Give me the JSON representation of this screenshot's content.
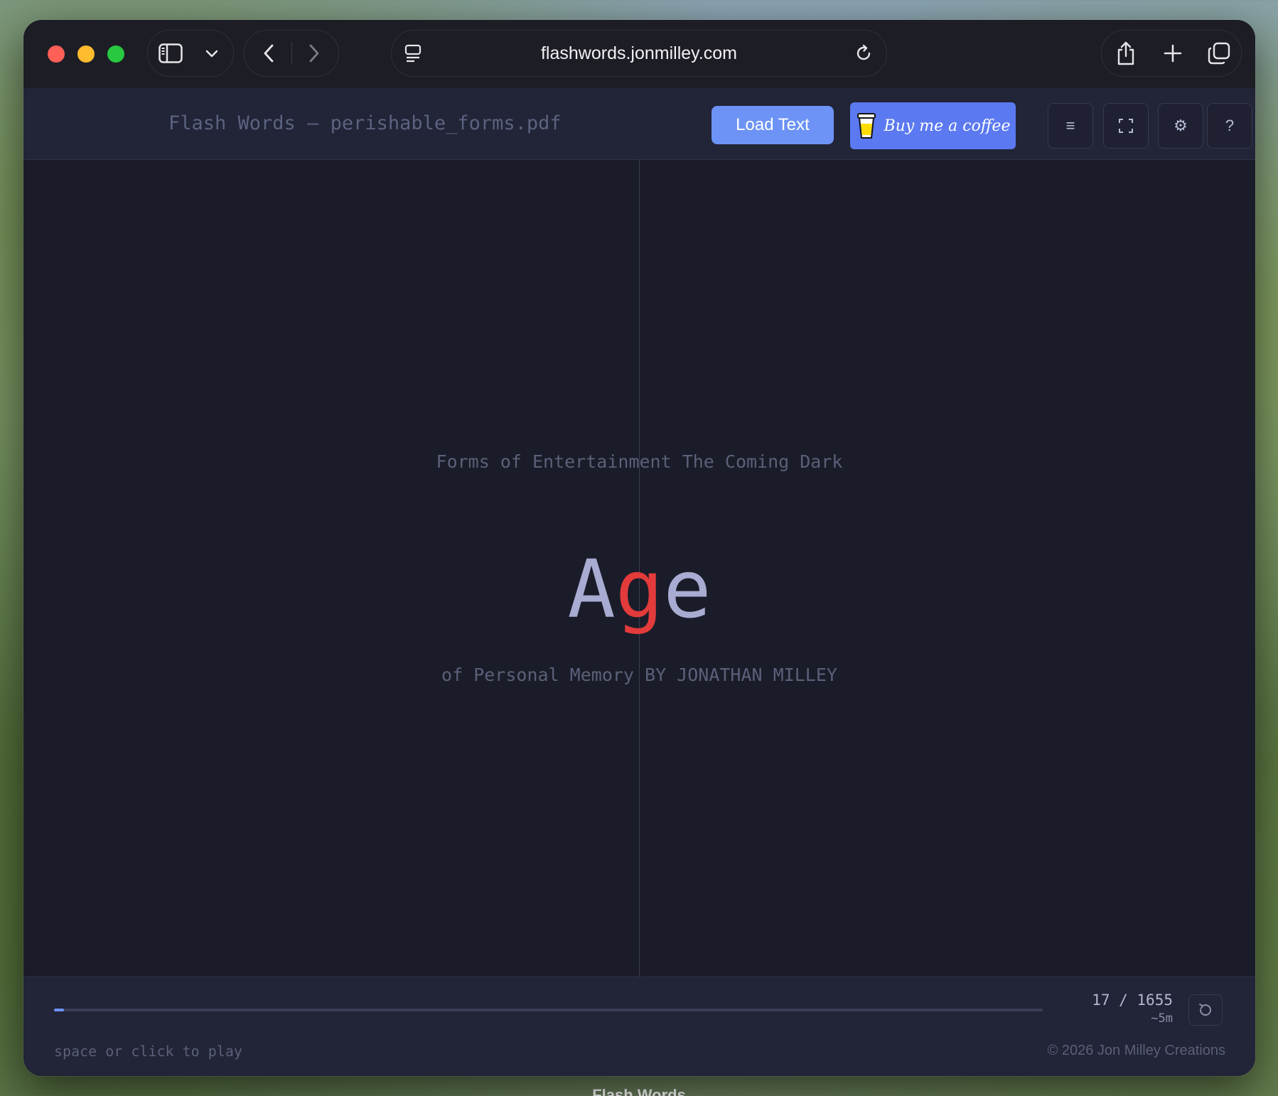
{
  "browser": {
    "url": "flashwords.jonmilley.com"
  },
  "app": {
    "title": "Flash Words – perishable_forms.pdf",
    "load_label": "Load Text",
    "coffee_label": "Buy me a coffee",
    "menu_glyph": "≡",
    "fullscreen_glyph": "⛶",
    "settings_glyph": "⚙",
    "help_glyph": "?"
  },
  "reader": {
    "context_before": "Forms of Entertainment The Coming Dark",
    "word_pre": "A",
    "word_orp": "g",
    "word_post": "e",
    "context_after": "of Personal Memory BY JONATHAN MILLEY",
    "orp_color": "#e33b3b",
    "word_color": "#a8acd2"
  },
  "footer": {
    "count": "17 / 1655",
    "time": "~5m",
    "progress_fraction": 0.0103,
    "hint": "space or click to play",
    "copyright": "© 2026 Jon Milley Creations"
  },
  "desktop": {
    "caption": "Flash Words"
  },
  "colors": {
    "accent": "#6c93f5",
    "coffee": "#5b79f0",
    "background": "#1b1c29"
  }
}
